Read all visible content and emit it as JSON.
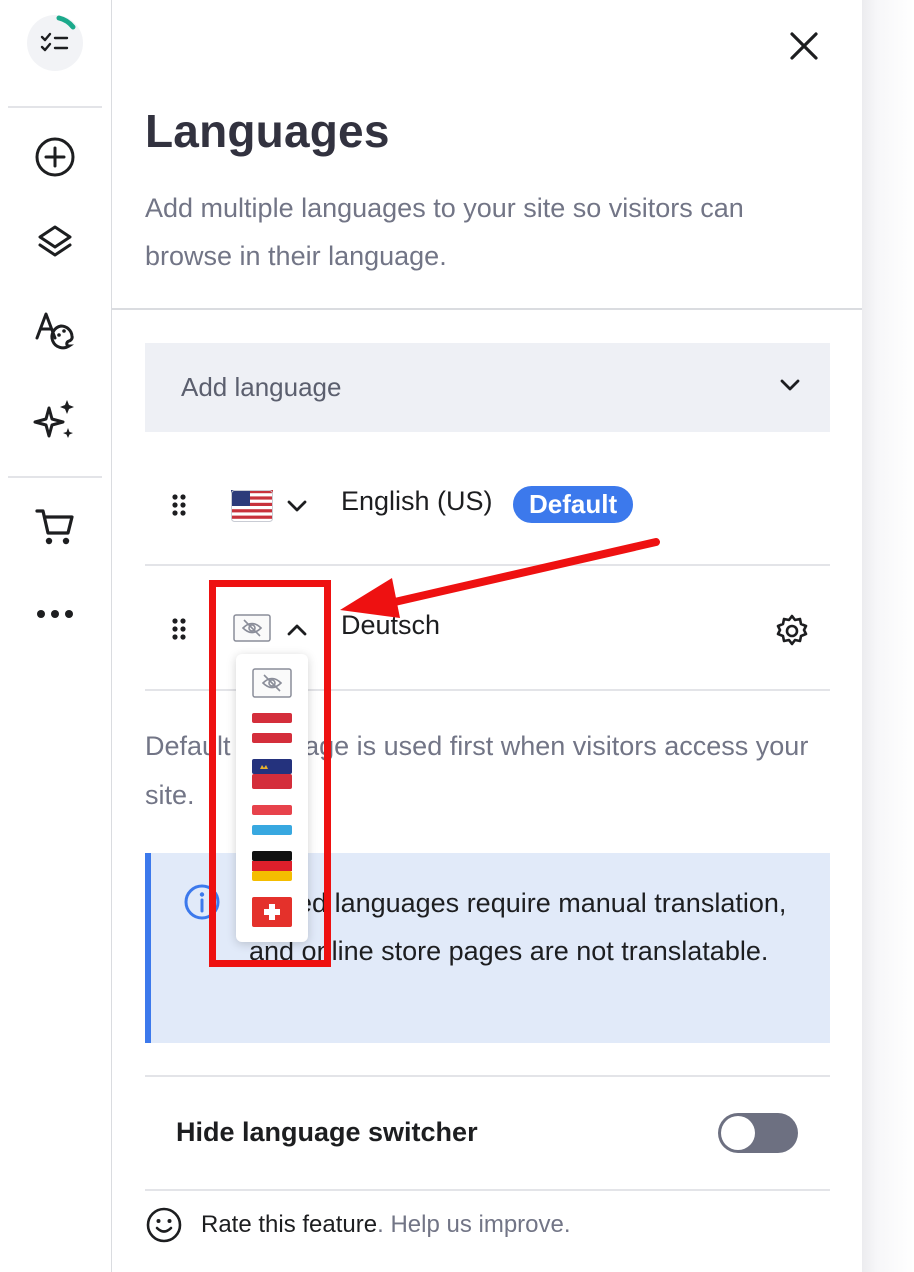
{
  "panel": {
    "title": "Languages",
    "subtitle": "Add multiple languages to your site so visitors can browse in their language.",
    "add_language_placeholder": "Add language"
  },
  "languages": [
    {
      "name": "English (US)",
      "badge": "Default",
      "flag": "us-flag-icon"
    },
    {
      "name": "Deutsch",
      "flag": "hidden-eye-icon"
    }
  ],
  "flag_dropdown": {
    "options": [
      "hidden-eye-icon",
      "austria-flag-icon",
      "liechtenstein-flag-icon",
      "luxembourg-flag-icon",
      "germany-flag-icon",
      "switzerland-flag-icon"
    ]
  },
  "note_text": "Default language is used first when visitors access your site.",
  "info_text": "Added languages require manual translation, and online store pages are not translatable.",
  "toggle": {
    "label": "Hide language switcher",
    "on": false
  },
  "rate": {
    "link": "Rate this feature",
    "rest": ". Help us improve."
  },
  "colors": {
    "accent": "#3c79ec",
    "info_bg": "#e1eaf9",
    "annotation": "#ee1111",
    "logo_progress": "#1ba98b"
  },
  "sidebar_icons": [
    "checklist-icon",
    "add-icon",
    "layers-icon",
    "design-icon",
    "ai-sparkle-icon",
    "cart-icon",
    "more-icon"
  ]
}
